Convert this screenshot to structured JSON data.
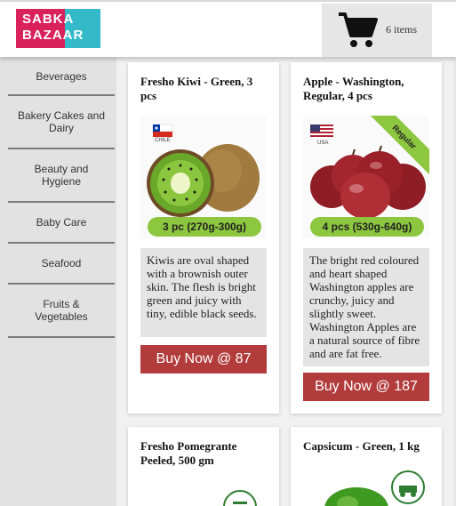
{
  "brand": {
    "logo_text": "SABKA BAZAAR",
    "line1": "SABKA",
    "line2": "BAZAAR",
    "pink": "#d9215b",
    "teal": "#34b9c8"
  },
  "cart": {
    "count_label": "6 items",
    "icon": "cart-icon"
  },
  "sidebar": {
    "items": [
      {
        "label": "Beverages"
      },
      {
        "label": "Bakery Cakes and Dairy"
      },
      {
        "label": "Beauty and Hygiene"
      },
      {
        "label": "Baby Care"
      },
      {
        "label": "Seafood"
      },
      {
        "label": "Fruits & Vegetables"
      }
    ]
  },
  "products": [
    {
      "name": "Fresho Kiwi - Green, 3 pcs",
      "origin": "CHILE",
      "pack": "3 pc (270g-300g)",
      "description": "Kiwis are oval shaped with a brownish outer skin. The flesh is bright green and juicy with tiny, edible black seeds.",
      "buy_label": "Buy Now @ 87"
    },
    {
      "name": "Apple - Washington, Regular, 4 pcs",
      "origin": "USA",
      "badge": "Regular",
      "pack": "4 pcs (530g-640g)",
      "description": "The bright red coloured and heart shaped Washington apples are crunchy, juicy and slightly sweet. Washington Apples are a natural source of fibre and are fat free.",
      "buy_label": "Buy Now @ 187"
    },
    {
      "name": "Fresho Pomegrante Peeled, 500 gm"
    },
    {
      "name": "Capsicum - Green, 1 kg"
    }
  ],
  "colors": {
    "buy_button": "#b23c3c",
    "pack_badge": "#8dc63f",
    "sidebar_bg": "#e2e2e2"
  }
}
